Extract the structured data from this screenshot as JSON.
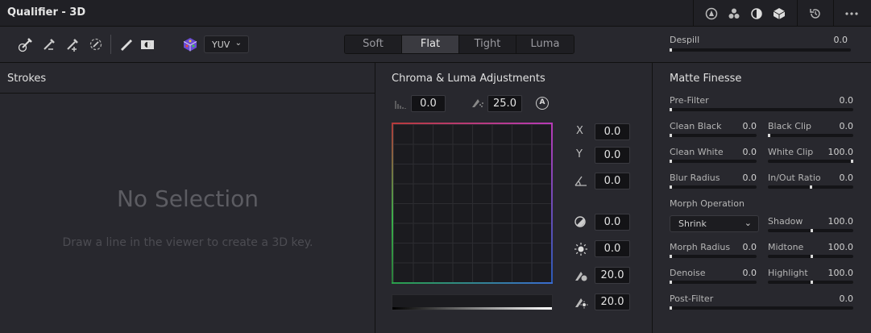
{
  "title": "Qualifier - 3D",
  "header_icons": [
    "qualifier-3d-icon",
    "color-dots-icon",
    "half-circle-icon",
    "cube-icon",
    "reset-icon",
    "more-icon"
  ],
  "toolbar": {
    "tools": [
      "eyedropper-icon",
      "eyedropper-minus-icon",
      "eyedropper-plus-icon",
      "eyedropper-feather-icon",
      "pen-icon",
      "highlight-icon",
      "color-cube-icon"
    ],
    "colorspace": "YUV",
    "modes": [
      "Soft",
      "Flat",
      "Tight",
      "Luma"
    ],
    "active_mode": "Flat",
    "despill_label": "Despill",
    "despill_value": "0.0"
  },
  "strokes": {
    "title": "Strokes",
    "empty_title": "No Selection",
    "empty_hint": "Draw a line in the viewer to create a 3D key."
  },
  "chroma": {
    "title": "Chroma & Luma Adjustments",
    "histogram_value": "0.0",
    "softness_value": "25.0",
    "auto_label": "A",
    "axis": {
      "x_label": "X",
      "y_label": "Y"
    },
    "x": "0.0",
    "y": "0.0",
    "rotation": "0.0",
    "contrast": "0.0",
    "brightness": "0.0",
    "low_soft": "20.0",
    "high_soft": "20.0"
  },
  "matte": {
    "title": "Matte Finesse",
    "pre_filter": {
      "label": "Pre-Filter",
      "value": "0.0"
    },
    "clean_black": {
      "label": "Clean Black",
      "value": "0.0"
    },
    "black_clip": {
      "label": "Black Clip",
      "value": "0.0"
    },
    "clean_white": {
      "label": "Clean White",
      "value": "0.0"
    },
    "white_clip": {
      "label": "White Clip",
      "value": "100.0"
    },
    "blur_radius": {
      "label": "Blur Radius",
      "value": "0.0"
    },
    "in_out_ratio": {
      "label": "In/Out Ratio",
      "value": "0.0"
    },
    "morph_operation": {
      "label": "Morph Operation",
      "value": "Shrink"
    },
    "shadow": {
      "label": "Shadow",
      "value": "100.0"
    },
    "morph_radius": {
      "label": "Morph Radius",
      "value": "0.0"
    },
    "midtone": {
      "label": "Midtone",
      "value": "100.0"
    },
    "denoise": {
      "label": "Denoise",
      "value": "0.0"
    },
    "highlight": {
      "label": "Highlight",
      "value": "100.0"
    },
    "post_filter": {
      "label": "Post-Filter",
      "value": "0.0"
    }
  }
}
